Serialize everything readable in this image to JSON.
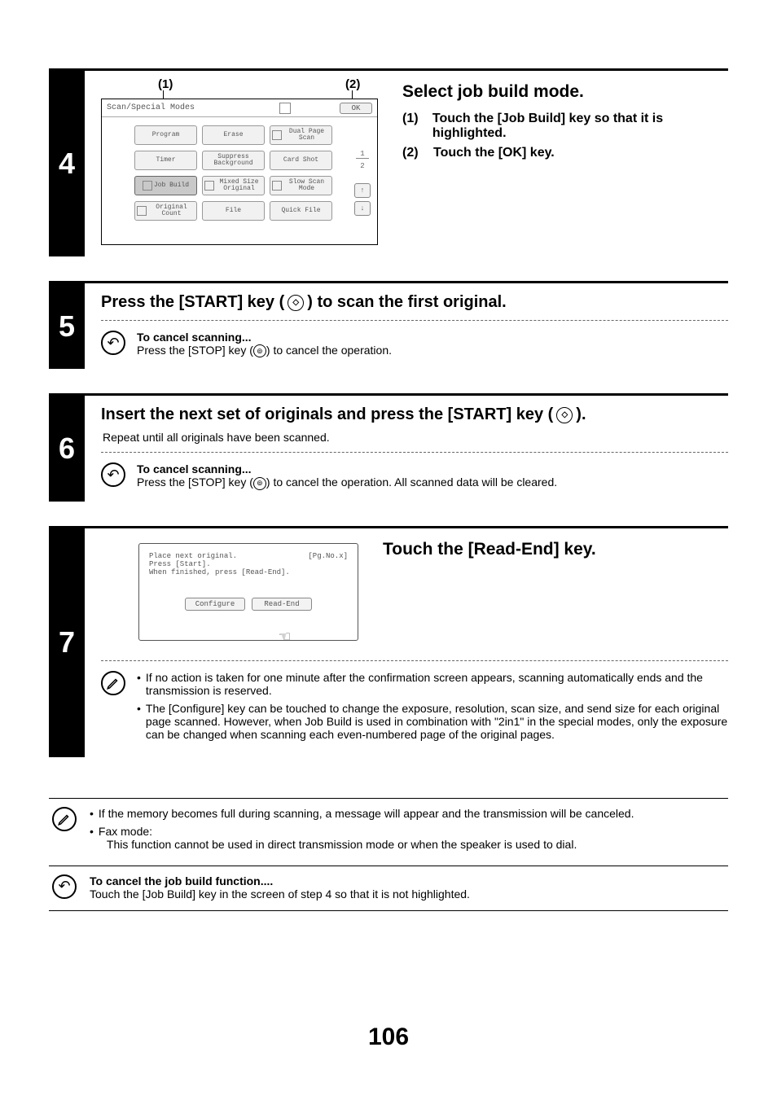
{
  "page_number": "106",
  "step4": {
    "number": "4",
    "callout1": "(1)",
    "callout2": "(2)",
    "panel": {
      "title": "Scan/Special Modes",
      "ok": "OK",
      "buttons": {
        "program": "Program",
        "erase": "Erase",
        "dual_page": "Dual Page\nScan",
        "timer": "Timer",
        "suppress_bg": "Suppress\nBackground",
        "card_shot": "Card Shot",
        "job_build": "Job\nBuild",
        "mixed_size": "Mixed Size\nOriginal",
        "slow_scan": "Slow Scan\nMode",
        "original_count": "Original\nCount",
        "file": "File",
        "quick_file": "Quick File"
      },
      "side": {
        "frac_top": "1",
        "frac_bot": "2",
        "up": "↑",
        "down": "↓"
      }
    },
    "heading": "Select job build mode.",
    "sub1_label": "(1)",
    "sub1_text": "Touch the [Job Build] key so that it is highlighted.",
    "sub2_label": "(2)",
    "sub2_text": "Touch the [OK] key."
  },
  "step5": {
    "number": "5",
    "heading_pre": "Press the [START] key (",
    "heading_post": ") to scan the first original.",
    "note_title": "To cancel scanning...",
    "note_pre": "Press the [STOP] key (",
    "note_post": ") to cancel the operation."
  },
  "step6": {
    "number": "6",
    "heading_pre": "Insert the next set of originals and press the [START] key (",
    "heading_post": ").",
    "sub_desc": "Repeat until all originals have been scanned.",
    "note_title": "To cancel scanning...",
    "note_pre": "Press the [STOP] key (",
    "note_post": ") to cancel the operation. All scanned data will be cleared."
  },
  "step7": {
    "number": "7",
    "heading": "Touch the [Read-End] key.",
    "panel": {
      "line1a": "Place next original.",
      "line1b": "[Pg.No.x]",
      "line2": "Press [Start].",
      "line3": "When finished, press [Read-End].",
      "configure": "Configure",
      "read_end": "Read-End"
    },
    "bullet1": "If no action is taken for one minute after the confirmation screen appears, scanning automatically ends and the transmission is reserved.",
    "bullet2": "The [Configure] key can be touched to change the exposure, resolution, scan size, and send size for each original page scanned. However, when Job Build is used in combination with \"2in1\" in the special modes, only the exposure can be changed when scanning each even-numbered page of the original pages."
  },
  "bottom": {
    "note_bullet1": "If the memory becomes full during scanning, a message will appear and the transmission will be canceled.",
    "note_bullet2a": "Fax mode:",
    "note_bullet2b": "This function cannot be used in direct transmission mode or when the speaker is used to dial.",
    "cancel_title": "To cancel the job build function....",
    "cancel_body": "Touch the [Job Build] key in the screen of step 4 so that it is not highlighted."
  }
}
